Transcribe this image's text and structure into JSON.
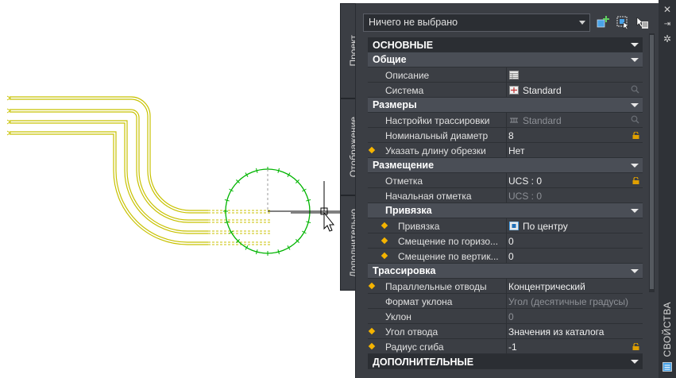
{
  "palette": {
    "selection": "Ничего не выбрано",
    "title": "СВОЙСТВА",
    "tabs": [
      "Проект",
      "Отображение",
      "Дополнительно"
    ]
  },
  "sections": {
    "main": "ОСНОВНЫЕ",
    "general": "Общие",
    "sizes": "Размеры",
    "placement": "Размещение",
    "snap": "Привязка",
    "routing": "Трассировка",
    "additional": "ДОПОЛНИТЕЛЬНЫЕ"
  },
  "props": {
    "description": {
      "label": "Описание",
      "value": ""
    },
    "system": {
      "label": "Система",
      "value": "Standard"
    },
    "routing_settings": {
      "label": "Настройки трассировки",
      "value": "Standard"
    },
    "nominal_diameter": {
      "label": "Номинальный диаметр",
      "value": "8"
    },
    "cut_length": {
      "label": "Указать длину обрезки",
      "value": "Нет"
    },
    "elevation": {
      "label": "Отметка",
      "value": "UCS : 0"
    },
    "start_elevation": {
      "label": "Начальная отметка",
      "value": "UCS : 0"
    },
    "snap": {
      "label": "Привязка",
      "value": "По центру"
    },
    "h_offset": {
      "label": "Смещение по горизо...",
      "value": "0"
    },
    "v_offset": {
      "label": "Смещение по вертик...",
      "value": "0"
    },
    "parallel": {
      "label": "Параллельные отводы",
      "value": "Концентрический"
    },
    "slope_format": {
      "label": "Формат уклона",
      "value": "Угол (десятичные градусы)"
    },
    "slope": {
      "label": "Уклон",
      "value": "0"
    },
    "elbow_angle": {
      "label": "Угол отвода",
      "value": "Значения из каталога"
    },
    "bend_radius": {
      "label": "Радиус сгиба",
      "value": "-1"
    }
  },
  "icons": {
    "quick_select": "quick-select-icon",
    "select_objects": "select-objects-icon",
    "toggle_pickadd": "toggle-pickadd-icon",
    "close": "close-icon",
    "autohide": "autohide-icon",
    "settings": "settings-icon"
  },
  "colors": {
    "pipe": "#c8c200",
    "circle": "#00b400",
    "accent_star": "#f5b400",
    "lock": "#e0a000"
  }
}
